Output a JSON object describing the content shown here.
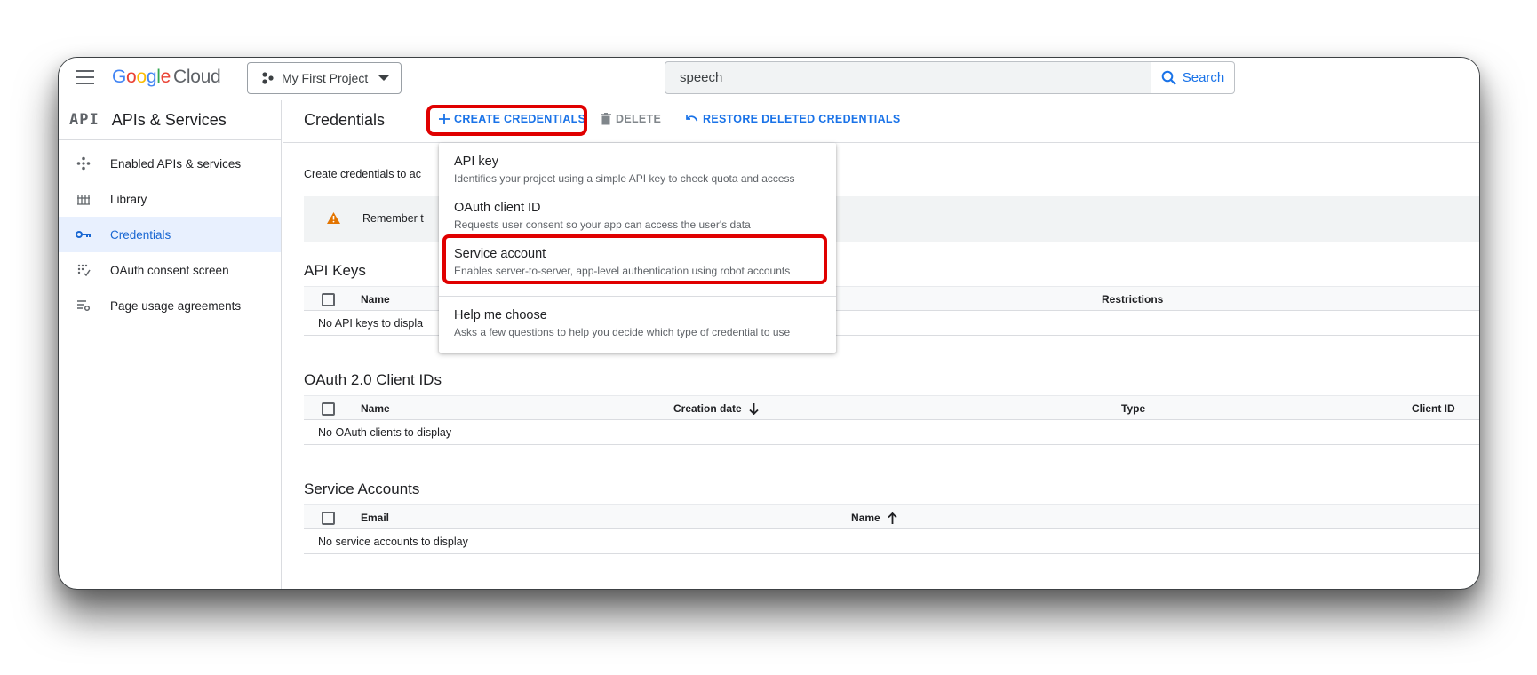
{
  "topbar": {
    "logo_letters": [
      "G",
      "o",
      "o",
      "g",
      "l",
      "e"
    ],
    "logo_suffix": "Cloud",
    "project_name": "My First Project",
    "search_value": "speech",
    "search_button_label": "Search"
  },
  "sidebar": {
    "title": "APIs & Services",
    "api_glyph": "API",
    "items": [
      {
        "label": "Enabled APIs & services",
        "icon": "hub-icon"
      },
      {
        "label": "Library",
        "icon": "library-icon"
      },
      {
        "label": "Credentials",
        "icon": "key-icon",
        "active": true
      },
      {
        "label": "OAuth consent screen",
        "icon": "consent-icon"
      },
      {
        "label": "Page usage agreements",
        "icon": "settings-list-icon"
      }
    ]
  },
  "main": {
    "title": "Credentials",
    "toolbar": {
      "create_label": "CREATE CREDENTIALS",
      "delete_label": "DELETE",
      "restore_label": "RESTORE DELETED CREDENTIALS"
    },
    "intro_text": "Create credentials to ac",
    "banner_text": "Remember t",
    "sections": {
      "api_keys": {
        "title": "API Keys",
        "columns": [
          "Name",
          "Restrictions"
        ],
        "empty_text": "No API keys to displa"
      },
      "oauth": {
        "title": "OAuth 2.0 Client IDs",
        "columns": [
          "Name",
          "Creation date",
          "Type",
          "Client ID"
        ],
        "empty_text": "No OAuth clients to display"
      },
      "service_accounts": {
        "title": "Service Accounts",
        "columns": [
          "Email",
          "Name"
        ],
        "empty_text": "No service accounts to display"
      }
    }
  },
  "menu": {
    "items": [
      {
        "title": "API key",
        "desc": "Identifies your project using a simple API key to check quota and access"
      },
      {
        "title": "OAuth client ID",
        "desc": "Requests user consent so your app can access the user's data"
      },
      {
        "title": "Service account",
        "desc": "Enables server-to-server, app-level authentication using robot accounts"
      },
      {
        "title": "Help me choose",
        "desc": "Asks a few questions to help you decide which type of credential to use"
      }
    ]
  },
  "colors": {
    "accent": "#1a73e8",
    "highlight": "#e00000",
    "warning": "#e37400",
    "active_bg": "#e8f0fe"
  }
}
